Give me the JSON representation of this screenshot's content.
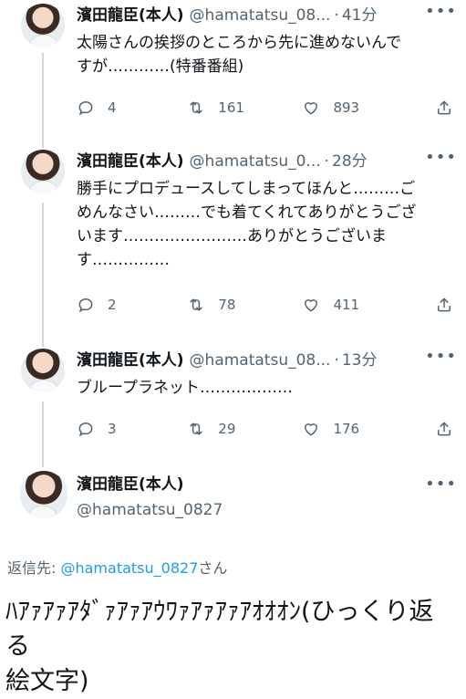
{
  "tweets": [
    {
      "name": "濱田龍臣(本人)",
      "handle": "@hamatatsu_08...",
      "dot": "·",
      "time": "41分",
      "text": "太陽さんの挨拶のところから先に進めないんで\nすが…………(特番番組)",
      "replies": "4",
      "retweets": "161",
      "likes": "893"
    },
    {
      "name": "濱田龍臣(本人)",
      "handle": "@hamatatsu_0...",
      "dot": "·",
      "time": "28分",
      "text": "勝手にプロデュースしてしまってほんと………ご\nめんなさい………でも着てくれてありがとうござ\nいます……………………ありがとうございま\nす……………",
      "replies": "2",
      "retweets": "78",
      "likes": "411"
    },
    {
      "name": "濱田龍臣(本人)",
      "handle": "@hamatatsu_08...",
      "dot": "·",
      "time": "13分",
      "text": "ブループラネット………………",
      "replies": "3",
      "retweets": "29",
      "likes": "176"
    }
  ],
  "main_tweet": {
    "name": "濱田龍臣(本人)",
    "handle": "@hamatatsu_0827",
    "reply_prefix": "返信先: ",
    "reply_mention": "@hamatatsu_0827",
    "reply_suffix": "さん",
    "text": "ﾊｱｧｱｧｱﾀﾞｧｱｧｱｳﾜｧｱｧｱｧｱｵｵｵﾝ(ひっくり返る\n絵文字)"
  },
  "more_label": "•••",
  "icons": [
    "reply-icon",
    "retweet-icon",
    "like-icon",
    "share-icon",
    "more-icon"
  ],
  "colors": {
    "accent": "#1d9bf0",
    "muted": "#536471",
    "text": "#0f1419",
    "thread": "#cfd9de"
  }
}
